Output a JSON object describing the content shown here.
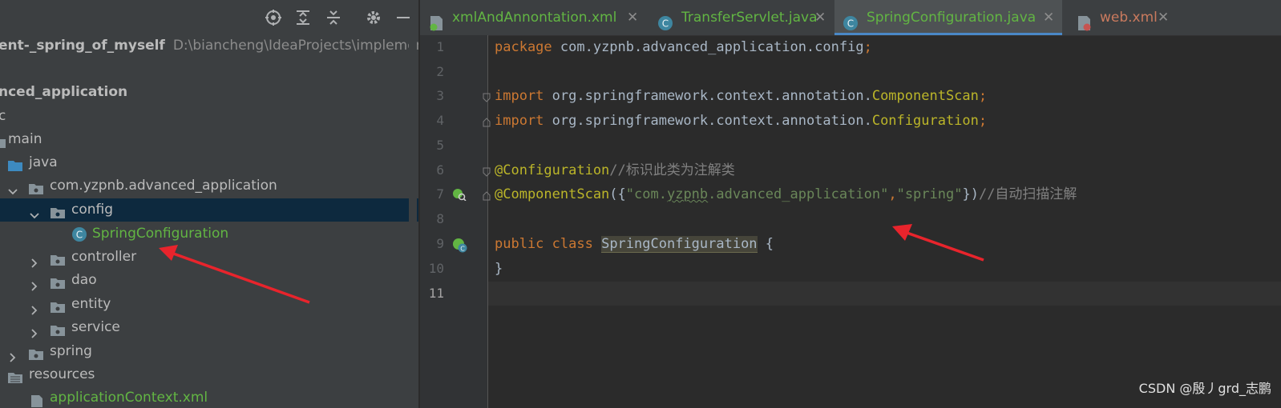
{
  "project": {
    "root": {
      "name": "ent-_spring_of_myself",
      "path": "D:\\biancheng\\IdeaProjects\\implement"
    },
    "tree": [
      {
        "label": "nced_application",
        "bold": true
      },
      {
        "label": "c"
      },
      {
        "label": "main"
      },
      {
        "label": "java"
      },
      {
        "label": "com.yzpnb.advanced_application"
      },
      {
        "label": "config"
      },
      {
        "label": "SpringConfiguration"
      },
      {
        "label": "controller"
      },
      {
        "label": "dao"
      },
      {
        "label": "entity"
      },
      {
        "label": "service"
      },
      {
        "label": "spring"
      },
      {
        "label": "resources"
      },
      {
        "label": "applicationContext.xml"
      }
    ]
  },
  "tabs": [
    {
      "label": "xmlAndAnnontation.xml",
      "close": "✕"
    },
    {
      "label": "TransferServlet.java",
      "close": "✕"
    },
    {
      "label": "SpringConfiguration.java",
      "close": "✕"
    },
    {
      "label": "web.xml",
      "close": "✕"
    }
  ],
  "editor": {
    "line_numbers": [
      "1",
      "2",
      "3",
      "4",
      "5",
      "6",
      "7",
      "8",
      "9",
      "10",
      "11"
    ],
    "code": {
      "l1_kw": "package",
      "l1_rest": " com.yzpnb.advanced_application.config",
      "semi": ";",
      "l3_kw": "import",
      "l3_pkg": " org.springframework.context.annotation.",
      "l3_cls": "ComponentScan",
      "l4_kw": "import",
      "l4_pkg": " org.springframework.context.annotation.",
      "l4_cls": "Configuration",
      "l6_ann": "@Configuration",
      "l6_cmt": "//标识此类为注解类",
      "l7_ann": "@ComponentScan",
      "l7_open": "({",
      "l7_s1q1": "\"com.",
      "l7_s1sq": "yzpnb",
      "l7_s1rest": ".advanced_application\"",
      "l7_comma": ",",
      "l7_s2": "\"spring\"",
      "l7_close": "})",
      "l7_cmt": "//自动扫描注解",
      "l9_kw": "public class",
      "l9_cls": "SpringConfiguration",
      "l9_brace": " {",
      "l10": "}"
    }
  },
  "watermark": "CSDN @殷丿grd_志鹏",
  "colors": {
    "keyword": "#cc7832",
    "annotation": "#bbb529",
    "string": "#6a8759",
    "comment": "#808080",
    "arrow": "#e8242c",
    "selection": "#0d293e"
  }
}
